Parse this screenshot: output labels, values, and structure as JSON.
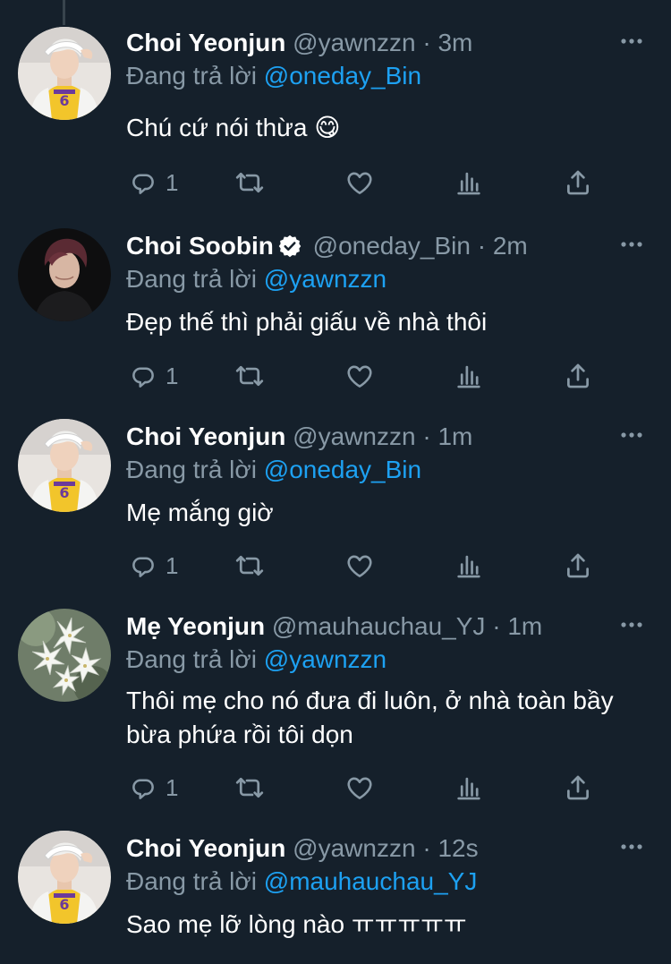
{
  "reply_prefix": "Đang trả lời",
  "tweets": [
    {
      "name": "Choi Yeonjun",
      "handle": "@yawnzzn",
      "time": "3m",
      "replying_to": "@oneday_Bin",
      "text": "Chú cứ nói thừa 😋",
      "reply_count": "1",
      "avatar": "avatar-yeonjun",
      "verified": false
    },
    {
      "name": "Choi Soobin",
      "handle": "@oneday_Bin",
      "time": "2m",
      "replying_to": "@yawnzzn",
      "text": "Đẹp thế thì phải giấu về nhà thôi",
      "reply_count": "1",
      "avatar": "avatar-soobin",
      "verified": true
    },
    {
      "name": "Choi Yeonjun",
      "handle": "@yawnzzn",
      "time": "1m",
      "replying_to": "@oneday_Bin",
      "text": "Mẹ mắng giờ",
      "reply_count": "1",
      "avatar": "avatar-yeonjun",
      "verified": false
    },
    {
      "name": "Mẹ Yeonjun",
      "handle": "@mauhauchau_YJ",
      "time": "1m",
      "replying_to": "@yawnzzn",
      "text": "Thôi mẹ cho nó đưa đi luôn, ở nhà toàn bầy bừa phứa rồi tôi dọn",
      "reply_count": "1",
      "avatar": "avatar-lilies",
      "verified": false
    },
    {
      "name": "Choi Yeonjun",
      "handle": "@yawnzzn",
      "time": "12s",
      "replying_to": "@mauhauchau_YJ",
      "text": "Sao mẹ lỡ lòng nào ㅠㅠㅠㅠㅠ",
      "avatar": "avatar-yeonjun",
      "verified": false
    }
  ],
  "icons": {
    "reply": "reply-icon",
    "retweet": "retweet-icon",
    "like": "heart-icon",
    "analytics": "analytics-icon",
    "share": "share-icon",
    "more": "more-icon",
    "verified": "verified-badge-icon"
  },
  "colors": {
    "background": "#15202b",
    "secondary_text": "#8899a6",
    "link": "#1da1f2",
    "thread_line": "#38444d"
  }
}
